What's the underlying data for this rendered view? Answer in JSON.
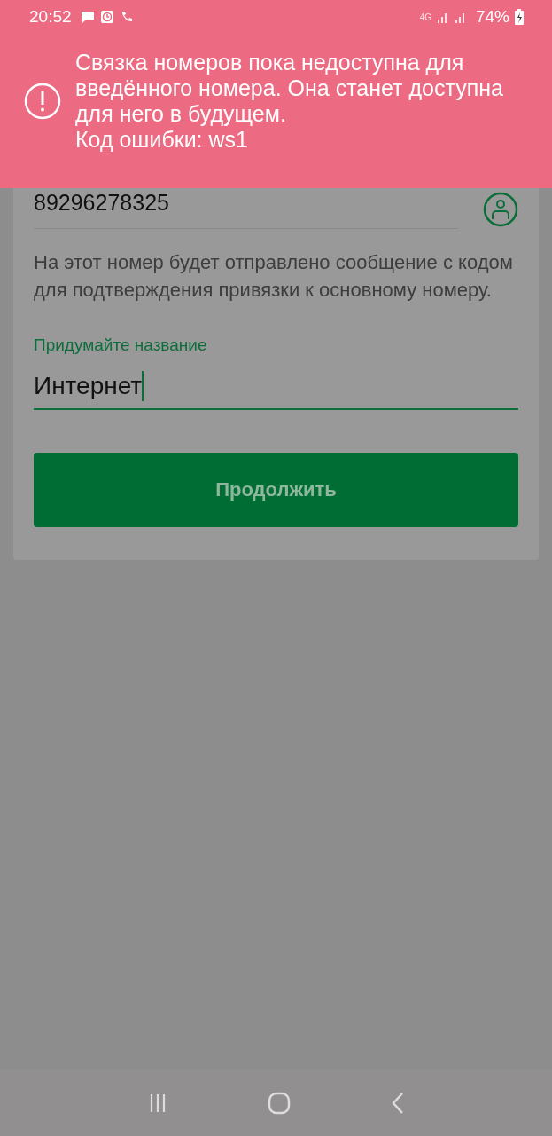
{
  "status_bar": {
    "time": "20:52",
    "network": "4G",
    "battery": "74%"
  },
  "error_banner": {
    "message": "Связка номеров пока недоступна для введённого номера. Она станет доступна для него в будущем.",
    "code": "Код ошибки: ws1"
  },
  "phone_field": {
    "value": "89296278325"
  },
  "info_text": "На этот номер будет отправлено сообщение с кодом для подтверждения привязки к основному номеру.",
  "name_field": {
    "label": "Придумайте название",
    "value": "Интернет",
    "focused": true
  },
  "continue_button": {
    "label": "Продолжить",
    "disabled": true
  }
}
